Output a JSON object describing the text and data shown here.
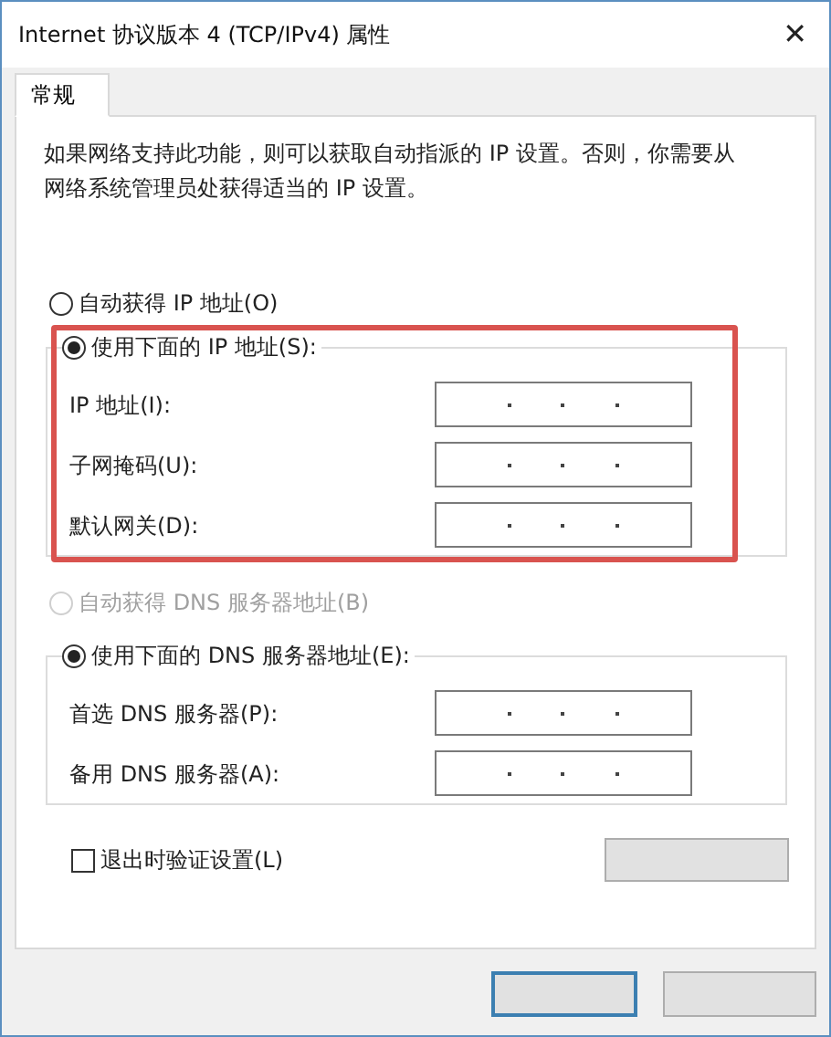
{
  "window": {
    "title": "Internet 协议版本 4 (TCP/IPv4) 属性",
    "close": "✕"
  },
  "tabs": [
    {
      "label": "常规",
      "selected": true
    }
  ],
  "description": "如果网络支持此功能，则可以获取自动指派的 IP 设置。否则，你需要从网络系统管理员处获得适当的 IP 设置。",
  "sections": [
    {
      "auto": {
        "label": "自动获得 IP 地址(O)",
        "selected": false,
        "disabled": false
      },
      "manual": {
        "label": "使用下面的 IP 地址(S):",
        "selected": true,
        "disabled": false
      },
      "fields": [
        {
          "label": "IP 地址(I):"
        },
        {
          "label": "子网掩码(U):"
        },
        {
          "label": "默认网关(D):"
        }
      ]
    },
    {
      "auto": {
        "label": "自动获得 DNS 服务器地址(B)",
        "selected": false,
        "disabled": true
      },
      "manual": {
        "label": "使用下面的 DNS 服务器地址(E):",
        "selected": true,
        "disabled": false
      },
      "fields": [
        {
          "label": "首选 DNS 服务器(P):"
        },
        {
          "label": "备用 DNS 服务器(A):"
        }
      ]
    }
  ],
  "validate": {
    "label": "退出时验证设置(L)",
    "checked": false
  }
}
